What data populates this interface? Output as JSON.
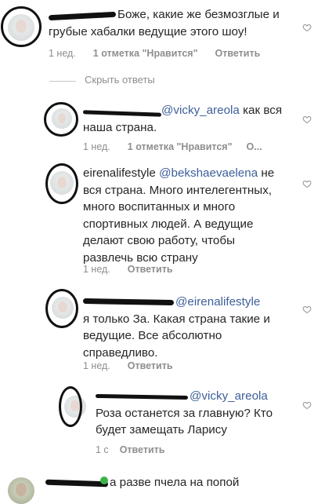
{
  "comments": [
    {
      "text": "Боже, какие же безмозглые и грубые хабалки ведущие этого шоу!",
      "time": "1 нед.",
      "likes": "1 отметка \"Нравится\"",
      "reply": "Ответить"
    },
    {
      "mention": "@vicky_areola",
      "text": " как вся наша страна.",
      "time": "1 нед.",
      "likes": "1 отметка \"Нравится\"",
      "reply": "О..."
    },
    {
      "username": "eirenalifestyle",
      "mention": "@bekshaevaelena",
      "text": " не вся страна. Много интелегентных, много воспитанных и много спортивных людей. А ведущие делают свою работу, чтобы развлечь всю страну",
      "time": "1 нед.",
      "reply": "Ответить"
    },
    {
      "mention": "@eirenalifestyle",
      "text": "я только За. Какая страна такие и ведущие. Все абсолютно справедливо.",
      "time": "1 нед.",
      "reply": "Ответить"
    },
    {
      "mention": "@vicky_areola",
      "text": "Роза останется за главную? Кто будет замещать Ларису",
      "time": "1 с",
      "reply": "Ответить"
    },
    {
      "text": "а разве пчела на попой"
    }
  ],
  "hide_replies": "Скрыть ответы",
  "colors": {
    "mention": "#3d5f9a",
    "meta": "#8e8e8e",
    "text": "#262626"
  }
}
